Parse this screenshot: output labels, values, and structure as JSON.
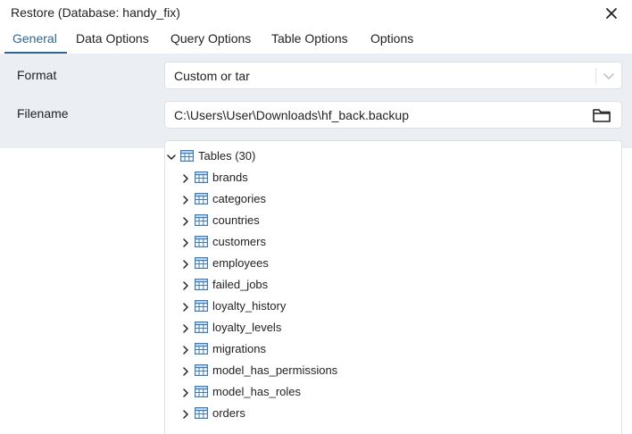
{
  "dialog": {
    "title": "Restore (Database: handy_fix)"
  },
  "tabs": [
    {
      "label": "General"
    },
    {
      "label": "Data Options"
    },
    {
      "label": "Query Options"
    },
    {
      "label": "Table Options"
    },
    {
      "label": "Options"
    }
  ],
  "form": {
    "format_label": "Format",
    "format_value": "Custom or tar",
    "filename_label": "Filename",
    "filename_value": "C:\\Users\\User\\Downloads\\hf_back.backup"
  },
  "tree": {
    "root_label": "Tables (30)",
    "items": [
      "brands",
      "categories",
      "countries",
      "customers",
      "employees",
      "failed_jobs",
      "loyalty_history",
      "loyalty_levels",
      "migrations",
      "model_has_permissions",
      "model_has_roles",
      "orders"
    ]
  },
  "colors": {
    "accent": "#326690",
    "panel_bg": "#ebeef3",
    "border": "#dde0e6",
    "icon": "#3d7ab8"
  },
  "icons": {
    "close": "close-icon",
    "dropdown": "chevron-down-icon",
    "folder": "folder-icon",
    "table": "table-icon"
  }
}
